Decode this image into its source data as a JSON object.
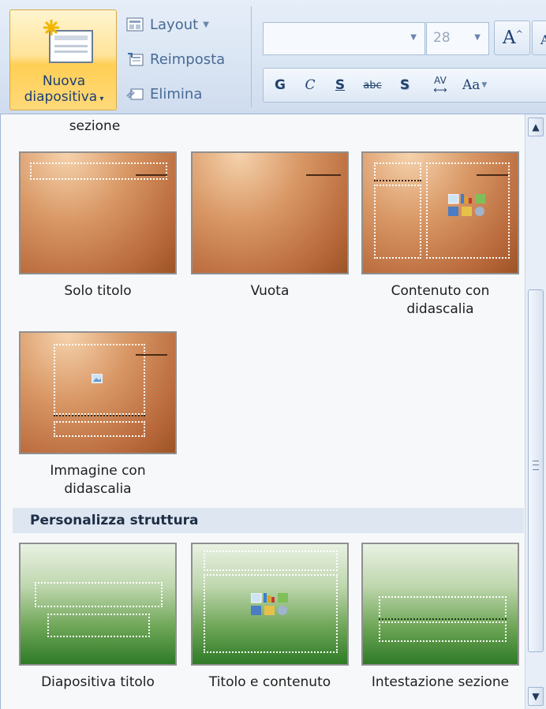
{
  "ribbon": {
    "new_slide": {
      "line1": "Nuova",
      "line2": "diapositiva"
    },
    "commands": [
      {
        "label": "Layout",
        "icon": "layout-icon"
      },
      {
        "label": "Reimposta",
        "icon": "reset-icon"
      },
      {
        "label": "Elimina",
        "icon": "delete-slide-icon"
      }
    ],
    "font_size": "28",
    "format_buttons": [
      "G",
      "C",
      "S",
      "abc",
      "S",
      "AV",
      "Aa"
    ]
  },
  "gallery": {
    "partial_label": "sezione",
    "tiles": [
      {
        "label": "Solo titolo"
      },
      {
        "label": "Vuota"
      },
      {
        "label": "Contenuto con didascalia"
      },
      {
        "label": "Immagine con didascalia"
      }
    ],
    "section_header": "Personalizza struttura",
    "custom_tiles": [
      {
        "label": "Diapositiva titolo"
      },
      {
        "label": "Titolo e contenuto"
      },
      {
        "label": "Intestazione sezione"
      }
    ]
  },
  "colors": {
    "ribbon_bg": "#dbe6f4",
    "highlight_button": "#ffd97a",
    "copper_theme": "#c07544",
    "green_theme": "#3d8b31",
    "section_header_bg": "#dde6f1"
  }
}
